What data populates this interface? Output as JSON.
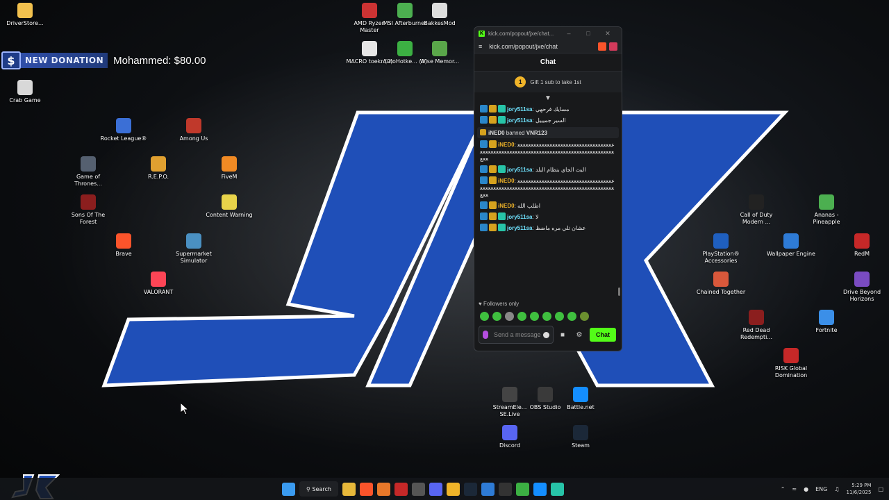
{
  "donation": {
    "badge": "$",
    "label": "NEW DONATION",
    "text": "Mohammed: $80.00"
  },
  "desktop_icons": [
    {
      "label": "DriverStore...",
      "color": "#f2c14e"
    },
    {
      "label": "Crab Game",
      "color": "#d8d8d8"
    },
    {
      "label": "Rocket League®",
      "color": "#3b6fd6"
    },
    {
      "label": "Among Us",
      "color": "#c0392b"
    },
    {
      "label": "Game of Thrones...",
      "color": "#556070"
    },
    {
      "label": "R.E.P.O.",
      "color": "#e0a030"
    },
    {
      "label": "FiveM",
      "color": "#f08a24"
    },
    {
      "label": "Sons Of The Forest",
      "color": "#8b1e1e"
    },
    {
      "label": "Content Warning",
      "color": "#e8d34a"
    },
    {
      "label": "Brave",
      "color": "#fb542b"
    },
    {
      "label": "Supermarket Simulator",
      "color": "#4a90c2"
    },
    {
      "label": "VALORANT",
      "color": "#fd4556"
    },
    {
      "label": "AMD Ryzen Master",
      "color": "#cc3333"
    },
    {
      "label": "MSI Afterburner",
      "color": "#4caf50"
    },
    {
      "label": "BakkesMod",
      "color": "#dddddd"
    },
    {
      "label": "MACRO toekr (2)",
      "color": "#e6e6e6"
    },
    {
      "label": "AutoHotke... (1)",
      "color": "#3cb043"
    },
    {
      "label": "Wise Memor...",
      "color": "#5aa64a"
    },
    {
      "label": "Call of Duty Modern ...",
      "color": "#222222"
    },
    {
      "label": "Ananas - Pineapple",
      "color": "#4caf50"
    },
    {
      "label": "PlayStation® Accessories",
      "color": "#1f5fbf"
    },
    {
      "label": "Wallpaper Engine",
      "color": "#2e7bd6"
    },
    {
      "label": "RedM",
      "color": "#c62828"
    },
    {
      "label": "Chained Together",
      "color": "#d9583b"
    },
    {
      "label": "Drive Beyond Horizons",
      "color": "#7a4bc2"
    },
    {
      "label": "Red Dead Redempti...",
      "color": "#8b1e1e"
    },
    {
      "label": "Fortnite",
      "color": "#3b8fe8"
    },
    {
      "label": "RISK Global Domination",
      "color": "#c62828"
    },
    {
      "label": "StreamEle... SE.Live",
      "color": "#444444"
    },
    {
      "label": "OBS Studio",
      "color": "#3a3a3a"
    },
    {
      "label": "Battle.net",
      "color": "#148eff"
    },
    {
      "label": "Discord",
      "color": "#5865f2"
    },
    {
      "label": "Steam",
      "color": "#1b2838"
    }
  ],
  "chat_window": {
    "title": "kick.com/popout/jxe/chat...",
    "url": "kick.com/popout/jxe/chat",
    "header": "Chat",
    "gift_rank": "1",
    "gift_text": "Gift 1 sub to take 1st",
    "messages": [
      {
        "type": "msg",
        "user": "jory511sa",
        "text": "مسايك فرحهي",
        "user_color": "#6fe3ff"
      },
      {
        "type": "msg",
        "user": "jory511sa",
        "text": "السير جميييل",
        "user_color": "#6fe3ff"
      },
      {
        "type": "sys",
        "actor": "iNED0",
        "action": "banned",
        "target": "VNR123"
      },
      {
        "type": "msg",
        "user": "iNED0",
        "text": "ععععععععععععععععععععععععععععععععععععععععععععععععععععععععععععععععععععععععععععععععععععععععع",
        "user_color": "#f0b429"
      },
      {
        "type": "msg",
        "user": "jory511sa",
        "text": "البث الجاي بنظام البلد",
        "user_color": "#6fe3ff"
      },
      {
        "type": "msg",
        "user": "iNED0",
        "text": "ععععععععععععععععععععععععععععععععععععععععععععععععععععععععععععععععععععععععععععععععععععععععع",
        "user_color": "#f0b429"
      },
      {
        "type": "msg",
        "user": "iNED0",
        "text": "اطلب الله",
        "user_color": "#f0b429"
      },
      {
        "type": "msg",
        "user": "jory511sa",
        "text": "لا",
        "user_color": "#6fe3ff"
      },
      {
        "type": "msg",
        "user": "jory511sa",
        "text": "عشان تلي مره ماضظ",
        "user_color": "#6fe3ff"
      }
    ],
    "followers_only": "Followers only",
    "input_placeholder": "Send a message",
    "send_label": "Chat"
  },
  "taskbar": {
    "search_label": "Search",
    "lang": "ENG",
    "time": "5:29 PM",
    "date": "11/6/2025"
  },
  "colors": {
    "accent_green": "#53fc18",
    "wallpaper_blue": "#1f4fb8"
  }
}
